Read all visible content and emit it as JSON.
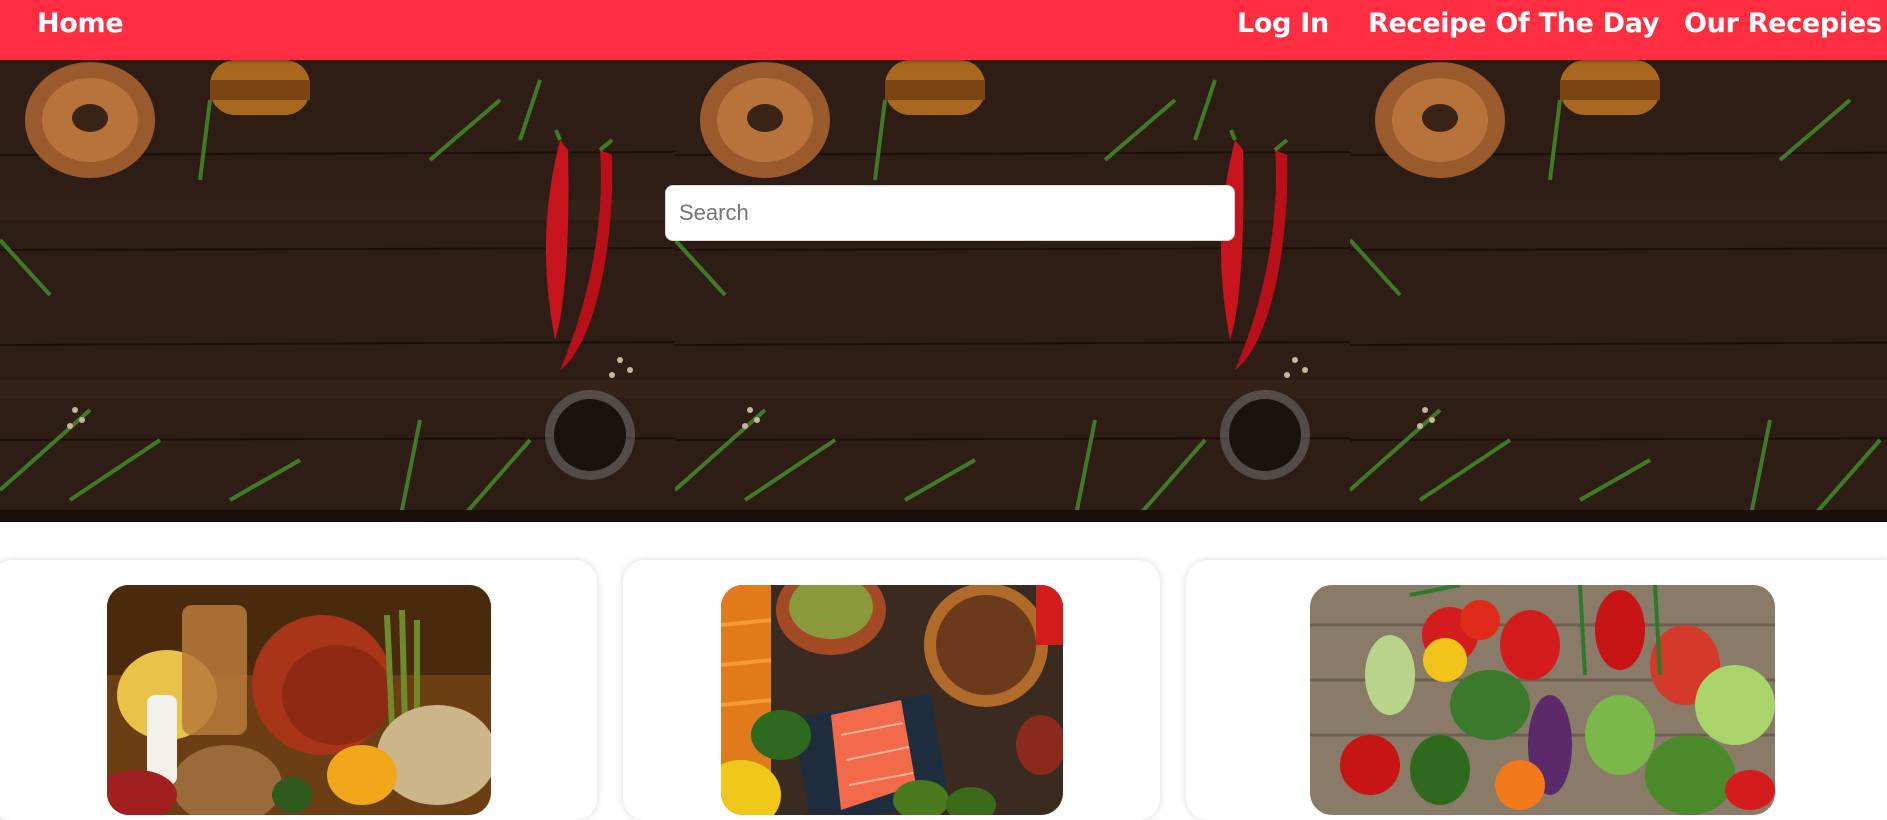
{
  "nav": {
    "home_label": "Home",
    "login_label": "Log In",
    "recipe_of_day_label": "Receipe Of The Day",
    "our_recipes_label": "Our Recepies"
  },
  "search": {
    "placeholder": "Search",
    "value": ""
  },
  "colors": {
    "accent": "#ff2d42",
    "wood_dark": "#2d1c14",
    "chili_red": "#c8141c",
    "rosemary_green": "#3f7a25"
  },
  "hero": {
    "background": "dark wooden table with rosemary, chili peppers and peppercorns",
    "tile_count": 3
  },
  "cards": [
    {
      "image": "assorted-foods-photo"
    },
    {
      "image": "healthy-foods-photo"
    },
    {
      "image": "fresh-vegetables-photo"
    }
  ]
}
